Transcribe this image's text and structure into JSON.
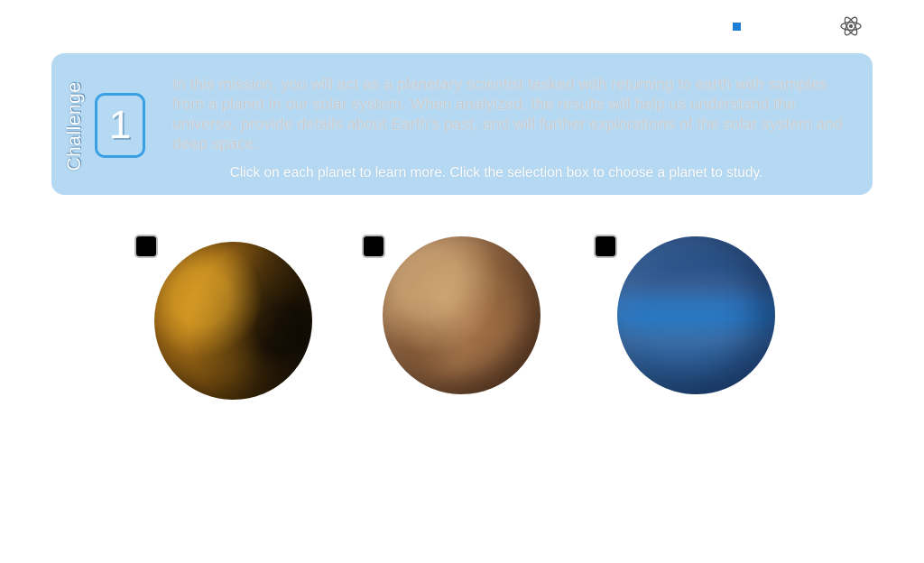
{
  "header": {
    "atom_icon": "atom-icon",
    "indicator_color": "#1b7fd6"
  },
  "challenge": {
    "label": "Challenge",
    "number": "1",
    "mission_text": "In this mission, you will act as a planetary scientist tasked with returning to earth with samples from a planet in our solar system. When analyized, the results will help us understand the universe, provide details about Earth's past, and will further explorations of the solar system and deep space.",
    "instructions": "Click on each planet to learn more. Click the selection box to choose a planet to study.",
    "banner_color": "#b5d9f3"
  },
  "planets": [
    {
      "selected": false,
      "color": "#a8701a"
    },
    {
      "selected": false,
      "color": "#a47650"
    },
    {
      "selected": false,
      "color": "#2f6fae"
    }
  ]
}
